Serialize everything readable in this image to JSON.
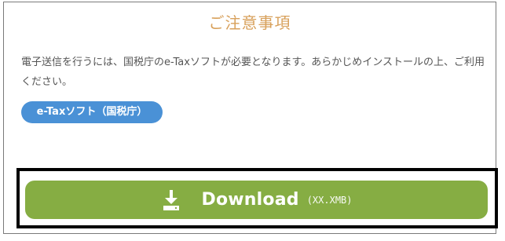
{
  "header": {
    "title": "ご注意事項"
  },
  "notice": {
    "text": "電子送信を行うには、国税庁のe-Taxソフトが必要となります。あらかじめインストールの上、ご利用ください。"
  },
  "links": {
    "etax_software_label": "e-Taxソフト（国税庁）"
  },
  "download": {
    "label": "Download",
    "size": "(XX.XMB)",
    "icon": "download-icon"
  },
  "colors": {
    "title": "#d8a15c",
    "text": "#555555",
    "pill": "#4a91d6",
    "download_button": "#86ad43",
    "download_outline": "#000000"
  }
}
